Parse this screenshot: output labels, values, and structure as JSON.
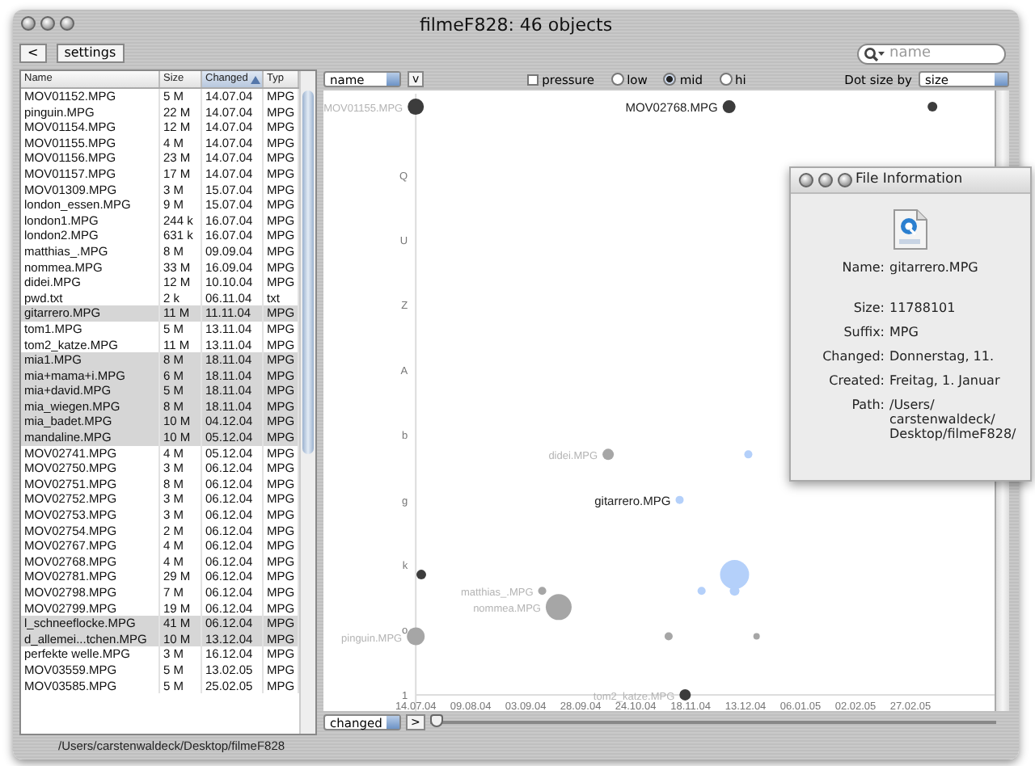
{
  "window": {
    "title": "filmeF828: 46 objects"
  },
  "toolbar": {
    "back_button": "<",
    "settings_button": "settings",
    "search": {
      "placeholder": "name"
    }
  },
  "table": {
    "columns": [
      {
        "label": "Name",
        "sorted": false
      },
      {
        "label": "Size",
        "sorted": false
      },
      {
        "label": "Changed",
        "sorted": true
      },
      {
        "label": "Typ",
        "sorted": false
      }
    ],
    "rows": [
      {
        "name": "MOV01152.MPG",
        "size": "5 M",
        "changed": "14.07.04",
        "type": "MPG",
        "selected": false
      },
      {
        "name": "pinguin.MPG",
        "size": "22 M",
        "changed": "14.07.04",
        "type": "MPG",
        "selected": false
      },
      {
        "name": "MOV01154.MPG",
        "size": "12 M",
        "changed": "14.07.04",
        "type": "MPG",
        "selected": false
      },
      {
        "name": "MOV01155.MPG",
        "size": "4 M",
        "changed": "14.07.04",
        "type": "MPG",
        "selected": false
      },
      {
        "name": "MOV01156.MPG",
        "size": "23 M",
        "changed": "14.07.04",
        "type": "MPG",
        "selected": false
      },
      {
        "name": "MOV01157.MPG",
        "size": "17 M",
        "changed": "14.07.04",
        "type": "MPG",
        "selected": false
      },
      {
        "name": "MOV01309.MPG",
        "size": "3 M",
        "changed": "15.07.04",
        "type": "MPG",
        "selected": false
      },
      {
        "name": "london_essen.MPG",
        "size": "9 M",
        "changed": "15.07.04",
        "type": "MPG",
        "selected": false
      },
      {
        "name": "london1.MPG",
        "size": "244 k",
        "changed": "16.07.04",
        "type": "MPG",
        "selected": false
      },
      {
        "name": "london2.MPG",
        "size": "631 k",
        "changed": "16.07.04",
        "type": "MPG",
        "selected": false
      },
      {
        "name": "matthias_.MPG",
        "size": "8 M",
        "changed": "09.09.04",
        "type": "MPG",
        "selected": false
      },
      {
        "name": "nommea.MPG",
        "size": "33 M",
        "changed": "16.09.04",
        "type": "MPG",
        "selected": false
      },
      {
        "name": "didei.MPG",
        "size": "12 M",
        "changed": "10.10.04",
        "type": "MPG",
        "selected": false
      },
      {
        "name": "pwd.txt",
        "size": "2 k",
        "changed": "06.11.04",
        "type": "txt",
        "selected": false
      },
      {
        "name": "gitarrero.MPG",
        "size": "11 M",
        "changed": "11.11.04",
        "type": "MPG",
        "selected": true
      },
      {
        "name": "tom1.MPG",
        "size": "5 M",
        "changed": "13.11.04",
        "type": "MPG",
        "selected": false
      },
      {
        "name": "tom2_katze.MPG",
        "size": "11 M",
        "changed": "13.11.04",
        "type": "MPG",
        "selected": false
      },
      {
        "name": "mia1.MPG",
        "size": "8 M",
        "changed": "18.11.04",
        "type": "MPG",
        "selected": true
      },
      {
        "name": "mia+mama+i.MPG",
        "size": "6 M",
        "changed": "18.11.04",
        "type": "MPG",
        "selected": true
      },
      {
        "name": "mia+david.MPG",
        "size": "5 M",
        "changed": "18.11.04",
        "type": "MPG",
        "selected": true
      },
      {
        "name": "mia_wiegen.MPG",
        "size": "8 M",
        "changed": "18.11.04",
        "type": "MPG",
        "selected": true
      },
      {
        "name": "mia_badet.MPG",
        "size": "10 M",
        "changed": "04.12.04",
        "type": "MPG",
        "selected": true
      },
      {
        "name": "mandaline.MPG",
        "size": "10 M",
        "changed": "05.12.04",
        "type": "MPG",
        "selected": true
      },
      {
        "name": "MOV02741.MPG",
        "size": "4 M",
        "changed": "05.12.04",
        "type": "MPG",
        "selected": false
      },
      {
        "name": "MOV02750.MPG",
        "size": "3 M",
        "changed": "06.12.04",
        "type": "MPG",
        "selected": false
      },
      {
        "name": "MOV02751.MPG",
        "size": "8 M",
        "changed": "06.12.04",
        "type": "MPG",
        "selected": false
      },
      {
        "name": "MOV02752.MPG",
        "size": "3 M",
        "changed": "06.12.04",
        "type": "MPG",
        "selected": false
      },
      {
        "name": "MOV02753.MPG",
        "size": "3 M",
        "changed": "06.12.04",
        "type": "MPG",
        "selected": false
      },
      {
        "name": "MOV02754.MPG",
        "size": "2 M",
        "changed": "06.12.04",
        "type": "MPG",
        "selected": false
      },
      {
        "name": "MOV02767.MPG",
        "size": "4 M",
        "changed": "06.12.04",
        "type": "MPG",
        "selected": false
      },
      {
        "name": "MOV02768.MPG",
        "size": "4 M",
        "changed": "06.12.04",
        "type": "MPG",
        "selected": false
      },
      {
        "name": "MOV02781.MPG",
        "size": "29 M",
        "changed": "06.12.04",
        "type": "MPG",
        "selected": false
      },
      {
        "name": "MOV02798.MPG",
        "size": "7 M",
        "changed": "06.12.04",
        "type": "MPG",
        "selected": false
      },
      {
        "name": "MOV02799.MPG",
        "size": "19 M",
        "changed": "06.12.04",
        "type": "MPG",
        "selected": false
      },
      {
        "name": "l_schneeflocke.MPG",
        "size": "41 M",
        "changed": "06.12.04",
        "type": "MPG",
        "selected": true
      },
      {
        "name": "d_allemei...tchen.MPG",
        "size": "10 M",
        "changed": "13.12.04",
        "type": "MPG",
        "selected": true
      },
      {
        "name": "perfekte welle.MPG",
        "size": "3 M",
        "changed": "16.12.04",
        "type": "MPG",
        "selected": false
      },
      {
        "name": "MOV03559.MPG",
        "size": "5 M",
        "changed": "13.02.05",
        "type": "MPG",
        "selected": false
      },
      {
        "name": "MOV03585.MPG",
        "size": "5 M",
        "changed": "25.02.05",
        "type": "MPG",
        "selected": false
      }
    ]
  },
  "status_bar": {
    "path": "/Users/carstenwaldeck/Desktop/filmeF828"
  },
  "plot_controls": {
    "y_axis_select": "name",
    "order_button": "v",
    "pressure": {
      "label": "pressure",
      "checked": false
    },
    "levels": [
      {
        "label": "low",
        "selected": false
      },
      {
        "label": "mid",
        "selected": true
      },
      {
        "label": "hi",
        "selected": false
      }
    ],
    "dot_size_label": "Dot size by",
    "dot_size_select": "size"
  },
  "plot": {
    "x_ticks": [
      "14.07.04",
      "09.08.04",
      "03.09.04",
      "28.09.04",
      "24.10.04",
      "18.11.04",
      "13.12.04",
      "06.01.05",
      "02.02.05",
      "27.02.05"
    ],
    "y_ticks": [
      "Q",
      "U",
      "Z",
      "A",
      "b",
      "g",
      "k",
      "o",
      "1"
    ],
    "point_labels": [
      {
        "text": "MOV01155.MPG",
        "highlighted": false
      },
      {
        "text": "MOV02768.MPG",
        "highlighted": true
      },
      {
        "text": "gitarrero.MPG",
        "highlighted": true
      },
      {
        "text": "didei.MPG",
        "highlighted": false
      },
      {
        "text": "pinguin.MPG",
        "highlighted": false
      },
      {
        "text": "tom2_katze.MPG",
        "highlighted": false
      },
      {
        "text": "matthias_.MPG",
        "highlighted": false
      },
      {
        "text": "nommea.MPG",
        "highlighted": false
      }
    ]
  },
  "x_axis_controls": {
    "x_axis_select": "changed",
    "order_button": ">",
    "zoom_slider": {
      "level": 0
    }
  },
  "file_info": {
    "title": "File Information",
    "fields": [
      {
        "label": "Name:",
        "lines": [
          "gitarrero.MPG"
        ]
      },
      {
        "label": "Size:",
        "lines": [
          "11788101"
        ]
      },
      {
        "label": "Suffix:",
        "lines": [
          "MPG"
        ]
      },
      {
        "label": "Changed:",
        "lines": [
          "Donnerstag, 11."
        ]
      },
      {
        "label": "Created:",
        "lines": [
          "Freitag, 1. Januar"
        ]
      },
      {
        "label": "Path:",
        "lines": [
          "/Users/",
          "carstenwaldeck/",
          "Desktop/filmeF828/"
        ]
      }
    ]
  }
}
